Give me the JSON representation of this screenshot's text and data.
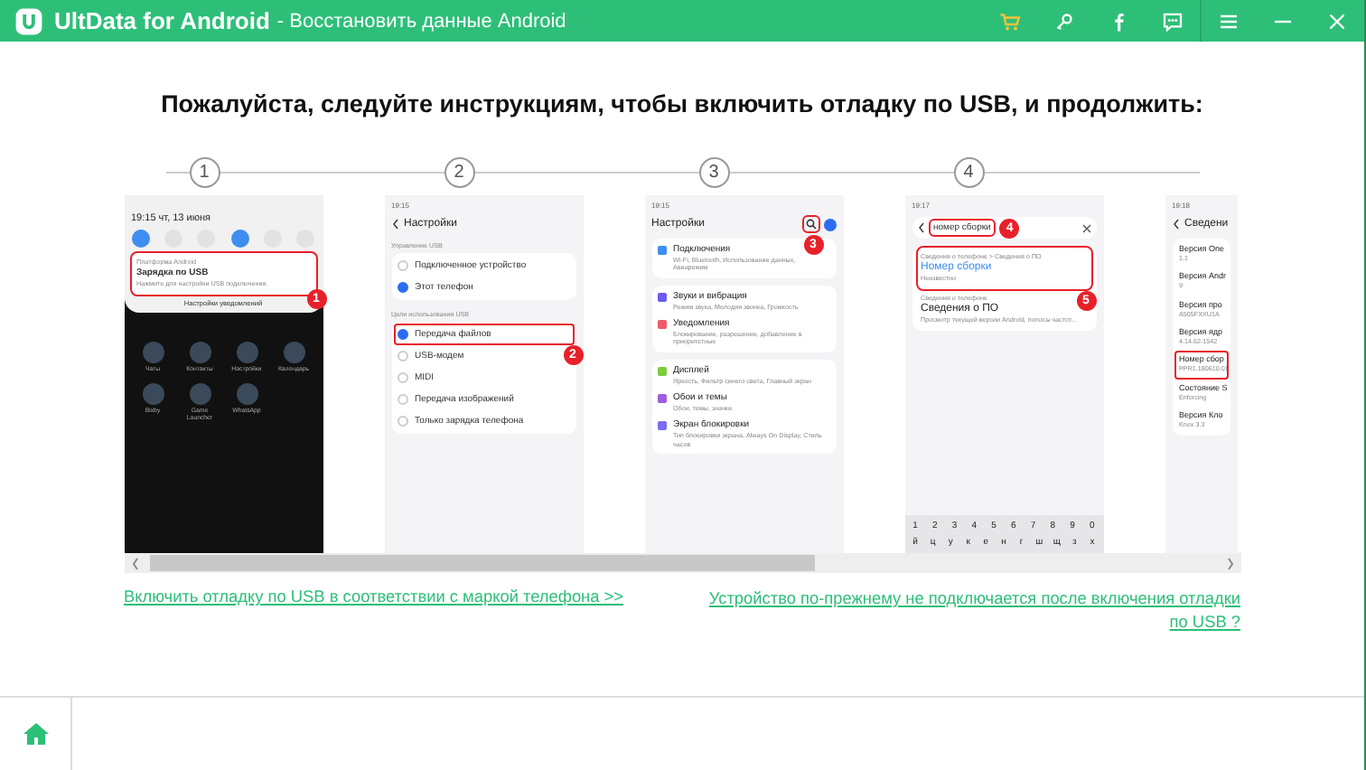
{
  "window": {
    "app_name": "UltData for Android",
    "subtitle": "- Восстановить данные Android"
  },
  "heading": "Пожалуйста, следуйте инструкциям, чтобы включить отладку по USB, и продолжить:",
  "steps": [
    "1",
    "2",
    "3",
    "4"
  ],
  "phones": [
    {
      "kind": "notification",
      "status_time": "19:15 чт, 13 июня",
      "toggles": [
        {
          "on": true
        },
        {
          "on": false
        },
        {
          "on": false
        },
        {
          "on": true
        },
        {
          "on": false
        },
        {
          "on": false
        }
      ],
      "source": "Платформа Android",
      "title": "Зарядка по USB",
      "text": "Нажмите для настройки USB подключения.",
      "action": "Настройки уведомлений",
      "badge": "1",
      "apps": [
        "Чаты",
        "Контакты",
        "Настройки",
        "Календарь",
        "Bixby",
        "Game Launcher",
        "WhatsApp"
      ]
    },
    {
      "kind": "usb",
      "status_time": "19:15",
      "title": "Настройки",
      "badge": "2",
      "sections": [
        {
          "label": "Управление USB",
          "options": [
            {
              "label": "Подключенное устройство",
              "selected": false,
              "highlighted": false
            },
            {
              "label": "Этот телефон",
              "selected": true,
              "highlighted": false
            }
          ]
        },
        {
          "label": "Цели использования USB",
          "options": [
            {
              "label": "Передача файлов",
              "selected": true,
              "highlighted": true
            },
            {
              "label": "USB-модем",
              "selected": false,
              "highlighted": false
            },
            {
              "label": "MIDI",
              "selected": false,
              "highlighted": false
            },
            {
              "label": "Передача изображений",
              "selected": false,
              "highlighted": false
            },
            {
              "label": "Только зарядка телефона",
              "selected": false,
              "highlighted": false
            }
          ]
        }
      ]
    },
    {
      "kind": "settings",
      "status_time": "19:15",
      "title": "Настройки",
      "badge": "3",
      "groups": [
        [
          {
            "title": "Подключения",
            "sub": "Wi-Fi, Bluetooth, Использование данных, Авиарежим",
            "color": "#3d8ef0"
          }
        ],
        [
          {
            "title": "Звуки и вибрация",
            "sub": "Режим звука, Мелодия звонка, Громкость",
            "color": "#6a5cf0"
          },
          {
            "title": "Уведомления",
            "sub": "Блокирование, разрешение, добавление в приоритетные",
            "color": "#ef5a6a"
          }
        ],
        [
          {
            "title": "Дисплей",
            "sub": "Яркость, Фильтр синего света, Главный экран",
            "color": "#7ccc3c"
          },
          {
            "title": "Обои и темы",
            "sub": "Обои, темы, значки",
            "color": "#a05ce0"
          },
          {
            "title": "Экран блокировки",
            "sub": "Тип блокировки экрана, Always On Display, Стиль часов",
            "color": "#7a6cf0"
          }
        ]
      ]
    },
    {
      "kind": "search",
      "status_time": "19:17",
      "query": "номер сборки",
      "badge": "4",
      "badge_result": "5",
      "results": [
        {
          "path": "Сведения о телефоне > Сведения о ПО",
          "title": "Номер сборки",
          "sub": "Неизвестно",
          "highlighted": true
        },
        {
          "path": "Сведения о телефоне",
          "title": "Сведения о ПО",
          "sub": "Просмотр текущей версии Android, полосы частот...",
          "highlighted": false
        }
      ],
      "key_rows": [
        [
          "1",
          "2",
          "3",
          "4",
          "5",
          "6",
          "7",
          "8",
          "9",
          "0"
        ],
        [
          "й",
          "ц",
          "у",
          "к",
          "е",
          "н",
          "г",
          "ш",
          "щ",
          "з",
          "х"
        ]
      ]
    },
    {
      "kind": "about",
      "status_time": "19:18",
      "title": "Сведени",
      "items": [
        {
          "title": "Версия One",
          "sub": "1.1",
          "highlighted": false
        },
        {
          "title": "Версия Andr",
          "sub": "9",
          "highlighted": false
        },
        {
          "title": "Версия про",
          "sub": "A505FXXU1A",
          "highlighted": false
        },
        {
          "title": "Версия ядр",
          "sub": "4.14.62-1542",
          "highlighted": false
        },
        {
          "title": "Номер сбор",
          "sub": "PPR1.180610.01",
          "highlighted": true
        },
        {
          "title": "Состояние S",
          "sub": "Enforcing",
          "highlighted": false
        },
        {
          "title": "Версия Кло",
          "sub": "Knox 3.3",
          "highlighted": false
        }
      ]
    }
  ],
  "links": {
    "left": "Включить отладку по USB в соответствии с маркой телефона >>",
    "right": "Устройство по-прежнему не подключается после включения отладки по USB ?"
  }
}
